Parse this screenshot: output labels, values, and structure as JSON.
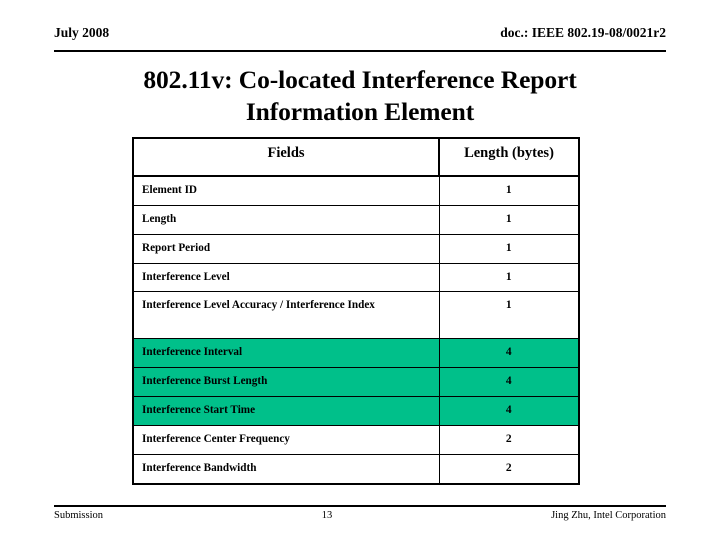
{
  "header": {
    "date": "July 2008",
    "document": "doc.: IEEE 802.19-08/0021r2"
  },
  "title": {
    "line1": "802.11v: Co-located Interference Report",
    "line2": "Information Element"
  },
  "table": {
    "columns": [
      "Fields",
      "Length (bytes)"
    ],
    "rows": [
      {
        "field": "Element ID",
        "length": "1",
        "highlight": false
      },
      {
        "field": "Length",
        "length": "1",
        "highlight": false
      },
      {
        "field": "Report Period",
        "length": "1",
        "highlight": false
      },
      {
        "field": "Interference Level",
        "length": "1",
        "highlight": false
      },
      {
        "field": "Interference Level Accuracy / Interference Index",
        "length": "1",
        "highlight": false,
        "tall": true
      },
      {
        "field": "Interference Interval",
        "length": "4",
        "highlight": true
      },
      {
        "field": "Interference Burst Length",
        "length": "4",
        "highlight": true
      },
      {
        "field": "Interference Start Time",
        "length": "4",
        "highlight": true
      },
      {
        "field": "Interference Center Frequency",
        "length": "2",
        "highlight": false
      },
      {
        "field": "Interference Bandwidth",
        "length": "2",
        "highlight": false
      }
    ],
    "highlight_color": "#00C08A"
  },
  "footer": {
    "left": "Submission",
    "page": "13",
    "right": "Jing Zhu, Intel Corporation"
  }
}
